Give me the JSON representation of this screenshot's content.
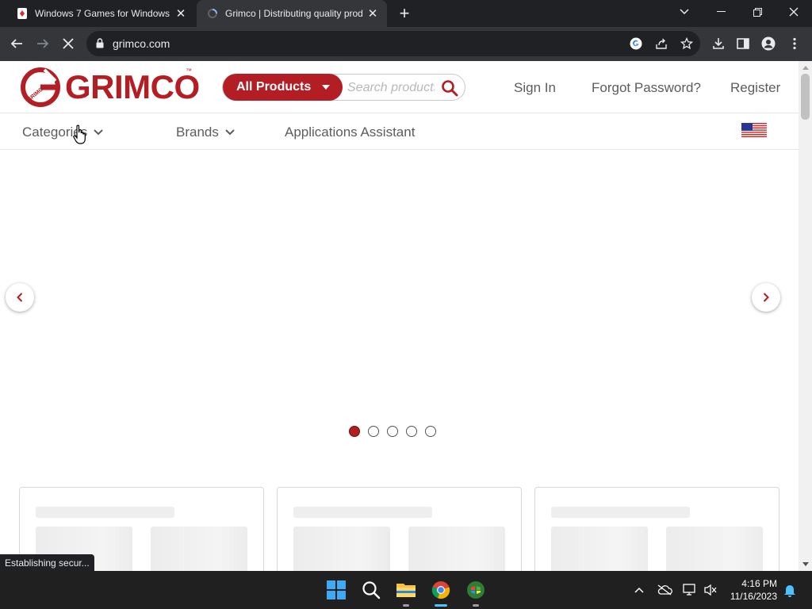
{
  "browser": {
    "tabs": [
      {
        "title": "Windows 7 Games for Windows",
        "active": false
      },
      {
        "title": "Grimco | Distributing quality prod",
        "active": true
      }
    ],
    "url": "grimco.com",
    "status_text": "Establishing secur..."
  },
  "site": {
    "logo_text": "GRIMCO",
    "logo_badge_text": "GRIMCO",
    "search": {
      "category_label": "All Products",
      "placeholder": "Search products"
    },
    "header_links": {
      "sign_in": "Sign In",
      "forgot_password": "Forgot Password?",
      "register": "Register"
    },
    "subnav": {
      "categories": "Categories",
      "brands": "Brands",
      "applications": "Applications Assistant"
    },
    "carousel": {
      "slide_count": 5,
      "active_slide": 1
    },
    "cards_loading": 3
  },
  "taskbar": {
    "time": "4:16 PM",
    "date": "11/16/2023"
  },
  "colors": {
    "brand_red": "#b31e24",
    "chrome_dark": "#202124",
    "chrome_toolbar": "#35363a",
    "taskbar": "#202020"
  }
}
